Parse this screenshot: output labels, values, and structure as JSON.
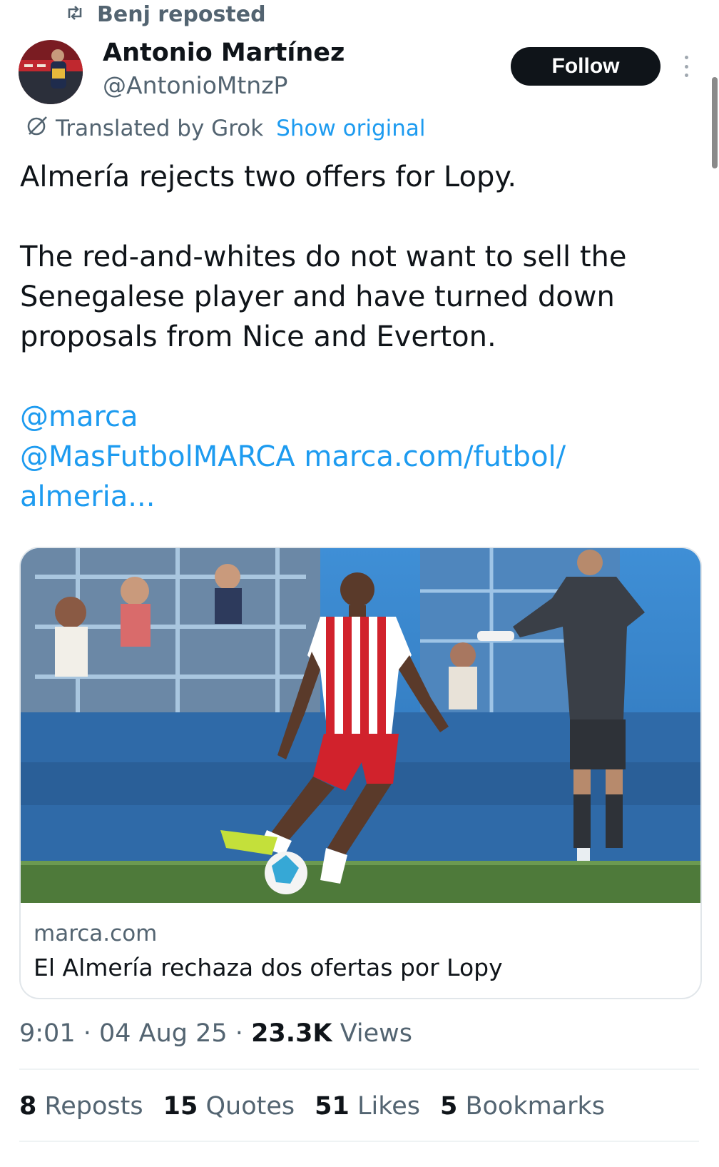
{
  "repost": {
    "icon": "repost-icon",
    "label": "Benj reposted"
  },
  "author": {
    "name": "Antonio Martínez",
    "handle": "@AntonioMtnzP"
  },
  "follow_label": "Follow",
  "translation": {
    "icon": "grok-icon",
    "label": "Translated by Grok",
    "show_original": "Show original"
  },
  "tweet": {
    "line1": "Almería rejects two offers for Lopy.",
    "paragraph2": "The red-and-whites do not want to sell the Senegalese player and have turned down proposals from Nice and Everton.",
    "mention1": "@marca",
    "mention2": "@MasFutbolMARCA",
    "url": "marca.com/futbol/ almeria..."
  },
  "card": {
    "domain": "marca.com",
    "title": "El Almería rechaza dos ofertas por Lopy"
  },
  "meta": {
    "time": "9:01",
    "date": "04 Aug 25",
    "views_count": "23.3K",
    "views_label": "Views"
  },
  "stats": [
    {
      "count": "8",
      "label": "Reposts"
    },
    {
      "count": "15",
      "label": "Quotes"
    },
    {
      "count": "51",
      "label": "Likes"
    },
    {
      "count": "5",
      "label": "Bookmarks"
    }
  ],
  "colors": {
    "accent": "#1d9bf0",
    "text": "#0f1419",
    "secondary": "#536471",
    "follow_bg": "#0f1419"
  }
}
